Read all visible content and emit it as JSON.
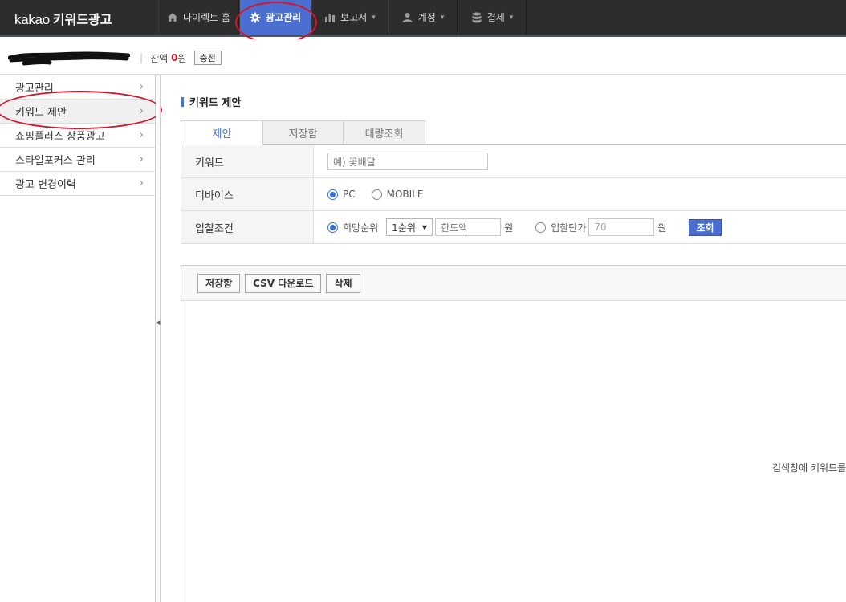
{
  "brand": {
    "logo": "kakao",
    "product": "키워드광고"
  },
  "nav": {
    "items": [
      {
        "label": "다이렉트 홈",
        "icon": "home-icon",
        "active": false,
        "dropdown": false
      },
      {
        "label": "광고관리",
        "icon": "gear-icon",
        "active": true,
        "dropdown": false
      },
      {
        "label": "보고서",
        "icon": "bar-chart-icon",
        "active": false,
        "dropdown": true
      },
      {
        "label": "계정",
        "icon": "user-icon",
        "active": false,
        "dropdown": true
      },
      {
        "label": "결제",
        "icon": "database-icon",
        "active": false,
        "dropdown": true
      }
    ]
  },
  "account": {
    "balance_label": "잔액",
    "balance_amount": "0",
    "balance_unit": "원",
    "charge_button": "충전"
  },
  "sidebar": {
    "items": [
      {
        "label": "광고관리"
      },
      {
        "label": "키워드 제안"
      },
      {
        "label": "쇼핑플러스 상품광고"
      },
      {
        "label": "스타일포커스 관리"
      },
      {
        "label": "광고 변경이력"
      }
    ]
  },
  "main": {
    "section_title": "키워드 제안",
    "tabs": [
      {
        "label": "제안",
        "active": true
      },
      {
        "label": "저장함",
        "active": false
      },
      {
        "label": "대량조회",
        "active": false
      }
    ],
    "form": {
      "keyword_label": "키워드",
      "keyword_placeholder": "예) 꽃배달",
      "device_label": "디바이스",
      "device_options": [
        {
          "label": "PC",
          "selected": true
        },
        {
          "label": "MOBILE",
          "selected": false
        }
      ],
      "bid_label": "입찰조건",
      "rank_option": "희망순위",
      "rank_selected": "1순위",
      "limit_placeholder": "한도액",
      "won": "원",
      "bid_price_option": "입찰단가",
      "bid_price_value": "70",
      "query_button": "조회"
    },
    "toolbar": {
      "save_button": "저장함",
      "csv_button": "CSV 다운로드",
      "delete_button": "삭제"
    },
    "empty_message": "검색창에 키워드를"
  },
  "colors": {
    "accent": "#4a6fd1",
    "annotation": "#d4142a",
    "topbar": "#2d2d2d"
  }
}
